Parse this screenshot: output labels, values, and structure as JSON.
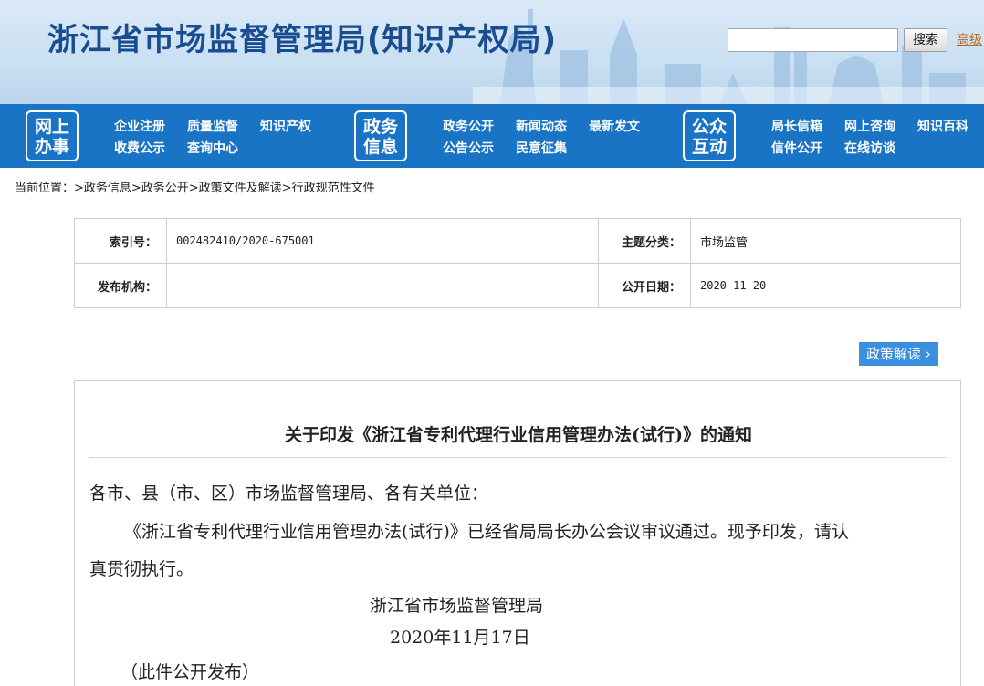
{
  "header": {
    "site_title": "浙江省市场监督管理局(知识产权局)",
    "search_placeholder": "",
    "search_button": "搜索",
    "advanced_link": "高级"
  },
  "nav": {
    "groups": [
      {
        "label_line1": "网上",
        "label_line2": "办事",
        "links": [
          "企业注册",
          "质量监督",
          "知识产权",
          "收费公示",
          "查询中心"
        ]
      },
      {
        "label_line1": "政务",
        "label_line2": "信息",
        "links": [
          "政务公开",
          "新闻动态",
          "最新发文",
          "公告公示",
          "民意征集"
        ]
      },
      {
        "label_line1": "公众",
        "label_line2": "互动",
        "links": [
          "局长信箱",
          "网上咨询",
          "知识百科",
          "信件公开",
          "在线访谈"
        ]
      }
    ]
  },
  "breadcrumb": "当前位置：>政务信息>政务公开>政策文件及解读>行政规范性文件",
  "info": {
    "index_label": "索引号：",
    "index_value": "002482410/2020-675001",
    "category_label": "主题分类：",
    "category_value": "市场监管",
    "publisher_label": "发布机构：",
    "publisher_value": "",
    "date_label": "公开日期：",
    "date_value": "2020-11-20"
  },
  "policy_button": "政策解读",
  "document": {
    "title": "关于印发《浙江省专利代理行业信用管理办法(试行)》的通知",
    "salutation": "各市、县（市、区）市场监督管理局、各有关单位：",
    "body_line1": "《浙江省专利代理行业信用管理办法(试行)》已经省局局长办公会议审议通过。现予印发，请认",
    "body_line2": "真贯彻执行。",
    "signature": "浙江省市场监督管理局",
    "date": "2020年11月17日",
    "note": "（此件公开发布）"
  }
}
